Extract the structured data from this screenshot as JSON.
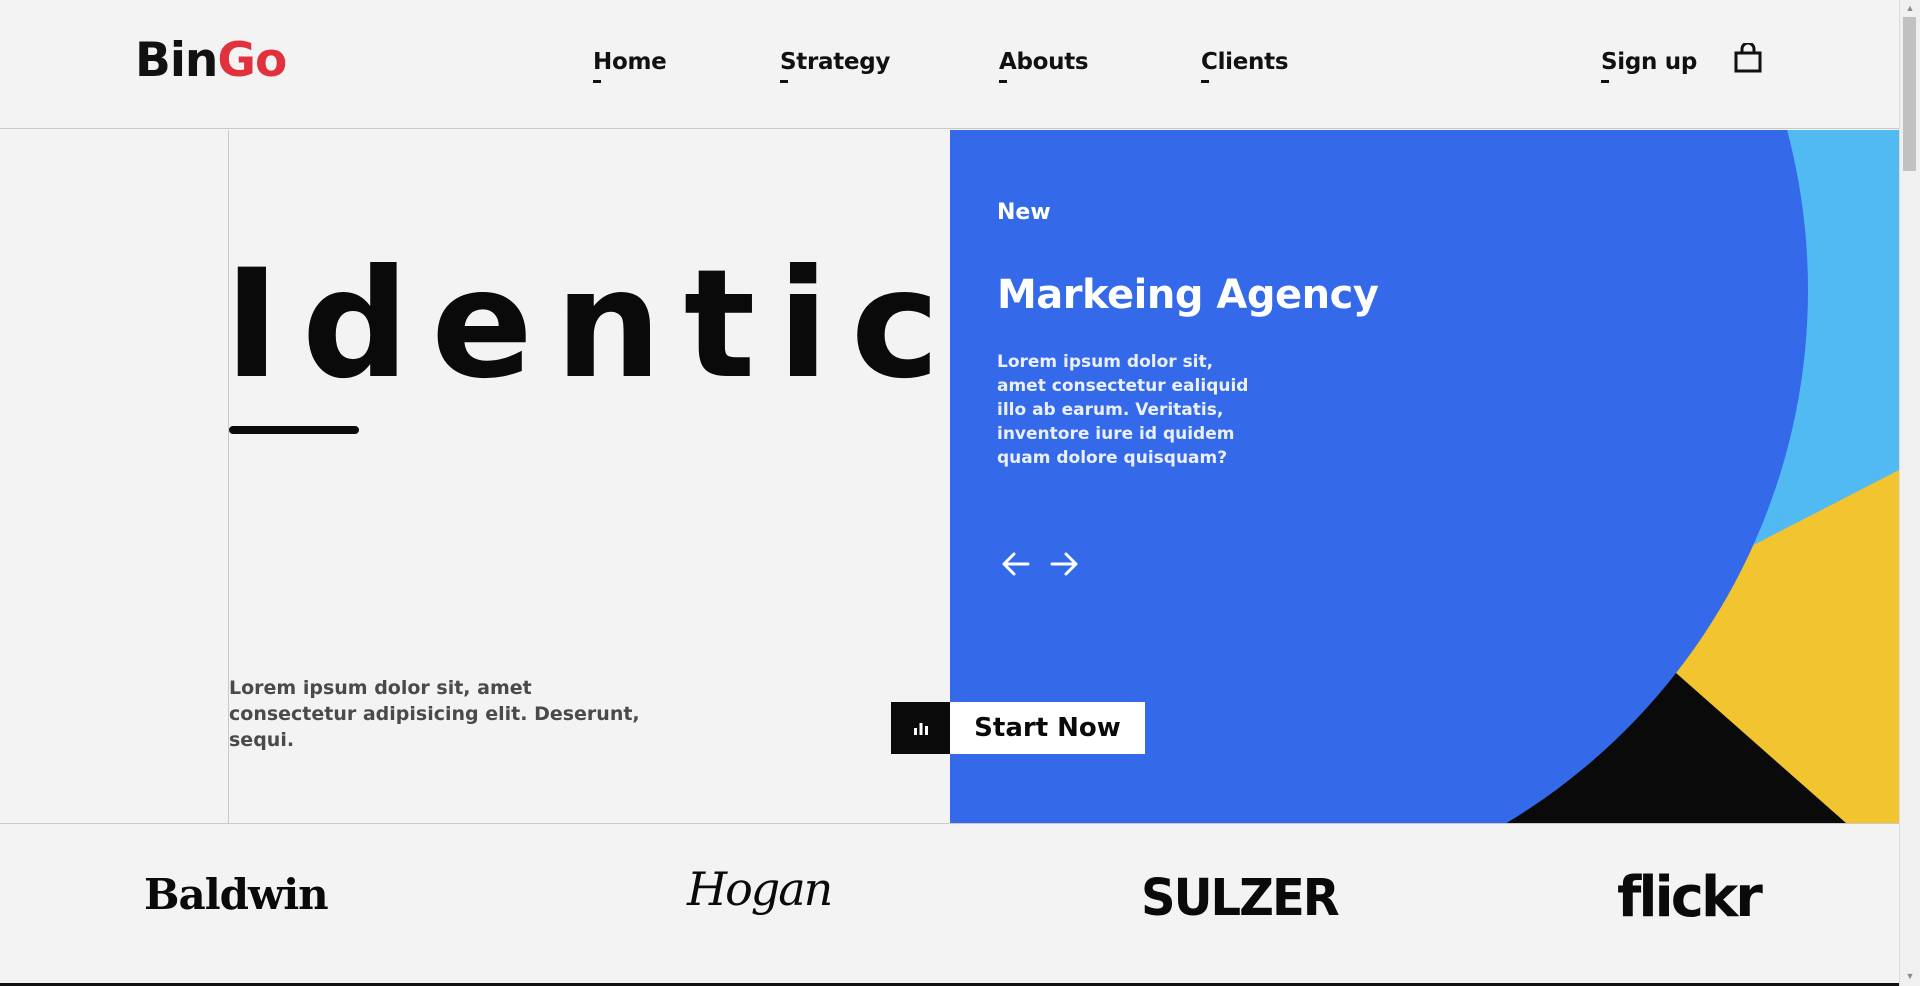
{
  "header": {
    "logo_part1": "Bin",
    "logo_part2": "Go",
    "nav": [
      "Home",
      "Strategy",
      "Abouts",
      "Clients"
    ],
    "signup_label": "Sign up",
    "cart_icon": "shopping-bag-icon"
  },
  "hero": {
    "word": "Identic",
    "description": "Lorem ipsum dolor sit, amet consectetur adipisicing elit. Deserunt, sequi.",
    "slide": {
      "badge": "New",
      "title": "Markeing Agency",
      "text": "Lorem ipsum dolor sit, amet consectetur ealiquid illo ab earum. Veritatis, inventore iure id quidem quam dolore quisquam?",
      "prev_icon": "arrow-left-icon",
      "next_icon": "arrow-right-icon"
    },
    "cta": {
      "icon": "bar-chart-icon",
      "label": "Start Now"
    }
  },
  "brands": [
    "Baldwin",
    "Hogan",
    "SULZER",
    "flickr"
  ],
  "colors": {
    "brand_red": "#e0313d",
    "hero_blue": "#346ae9",
    "sky_blue": "#52baf3",
    "pink": "#e04b78",
    "yellow": "#f2c42f",
    "black": "#0a0a0a"
  }
}
